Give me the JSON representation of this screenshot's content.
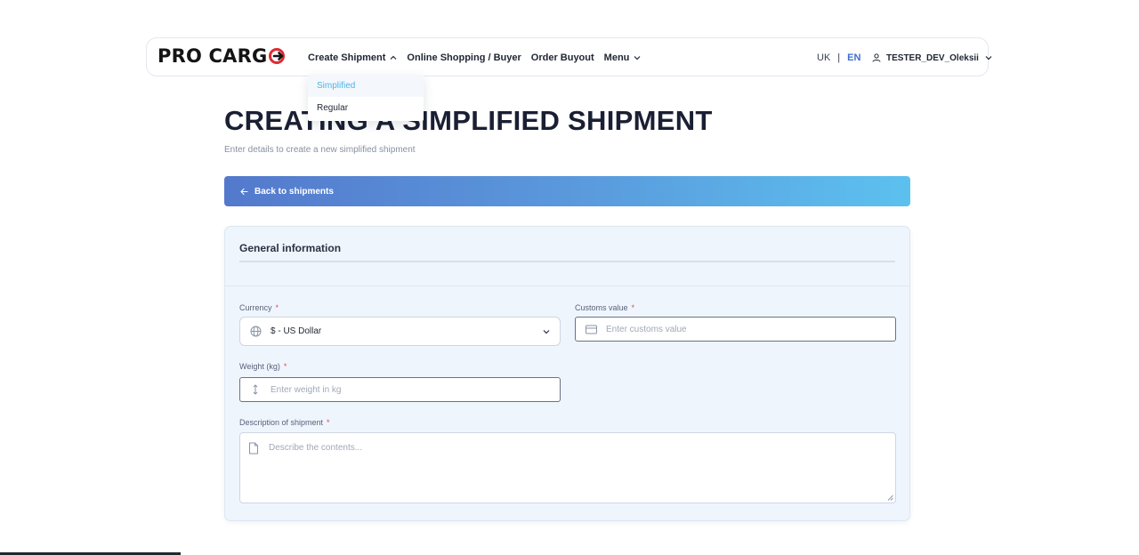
{
  "brand": {
    "logo_text": "PRO CARG"
  },
  "nav": {
    "links": [
      {
        "label": "Create Shipment"
      },
      {
        "label": "Online Shopping / Buyer"
      },
      {
        "label": "Order Buyout"
      },
      {
        "label": "Menu"
      }
    ],
    "lang": {
      "uk": "UK",
      "sep": "|",
      "en": "EN",
      "active": "EN"
    },
    "user": "TESTER_DEV_Oleksii"
  },
  "dropdown": {
    "items": [
      {
        "label": "Simplified",
        "active": true
      },
      {
        "label": "Regular",
        "active": false
      }
    ]
  },
  "page": {
    "title": "CREATING A SIMPLIFIED SHIPMENT",
    "subtitle": "Enter details to create a new simplified shipment",
    "back_label": "Back to shipments"
  },
  "form": {
    "section_title": "General information",
    "required_mark": "*",
    "currency": {
      "label": "Currency",
      "value": "$ - US Dollar"
    },
    "customs": {
      "label": "Customs value",
      "placeholder": "Enter customs value"
    },
    "weight": {
      "label": "Weight (kg)",
      "placeholder": "Enter weight in kg"
    },
    "description": {
      "label": "Description of shipment",
      "placeholder": "Describe the contents..."
    }
  },
  "colors": {
    "accent": "#3d6fd1",
    "active_menu": "#4fb3e6",
    "logo_red": "#e02a35",
    "required": "#e24a5a",
    "gradient_start": "#5479cc",
    "gradient_end": "#5cc1ef"
  }
}
